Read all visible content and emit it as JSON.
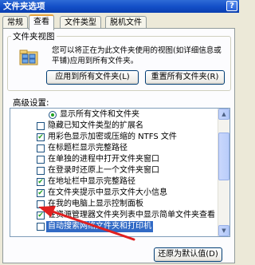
{
  "window": {
    "title": "文件夹选项",
    "help_label": "?"
  },
  "tabs": [
    {
      "label": "常规",
      "active": false
    },
    {
      "label": "查看",
      "active": true
    },
    {
      "label": "文件类型",
      "active": false
    },
    {
      "label": "脱机文件",
      "active": false
    }
  ],
  "folder_views": {
    "legend": "文件夹视图",
    "description": "您可以将正在为此文件夹使用的视图(如详细信息或平铺)应用到所有文件夹。",
    "apply_all_label": "应用到所有文件夹(L)",
    "reset_all_label": "重置所有文件夹(R)",
    "icon": "folder-options-icon"
  },
  "advanced": {
    "label": "高级设置:",
    "items": [
      {
        "type": "radio",
        "checked": true,
        "indent": 2,
        "label": "显示所有文件和文件夹"
      },
      {
        "type": "checkbox",
        "checked": false,
        "indent": 1,
        "label": "隐藏已知文件类型的扩展名"
      },
      {
        "type": "checkbox",
        "checked": true,
        "indent": 1,
        "label": "用彩色显示加密或压缩的 NTFS 文件"
      },
      {
        "type": "checkbox",
        "checked": false,
        "indent": 1,
        "label": "在标题栏显示完整路径"
      },
      {
        "type": "checkbox",
        "checked": false,
        "indent": 1,
        "label": "在单独的进程中打开文件夹窗口"
      },
      {
        "type": "checkbox",
        "checked": false,
        "indent": 1,
        "label": "在登录时还原上一个文件夹窗口"
      },
      {
        "type": "checkbox",
        "checked": true,
        "indent": 1,
        "label": "在地址栏中显示完整路径"
      },
      {
        "type": "checkbox",
        "checked": true,
        "indent": 1,
        "label": "在文件夹提示中显示文件大小信息"
      },
      {
        "type": "checkbox",
        "checked": false,
        "indent": 1,
        "label": "在我的电脑上显示控制面板"
      },
      {
        "type": "checkbox",
        "checked": true,
        "indent": 1,
        "label": "在资源管理器文件夹列表中显示简单文件夹查看"
      },
      {
        "type": "checkbox",
        "checked": false,
        "indent": 1,
        "label": "自动搜索网络文件夹和打印机",
        "selected": true
      }
    ],
    "restore_defaults_label": "还原为默认值(D)"
  },
  "colors": {
    "selection": "#316ac5",
    "annotation_arrow": "#e02020",
    "check": "#21a121"
  }
}
